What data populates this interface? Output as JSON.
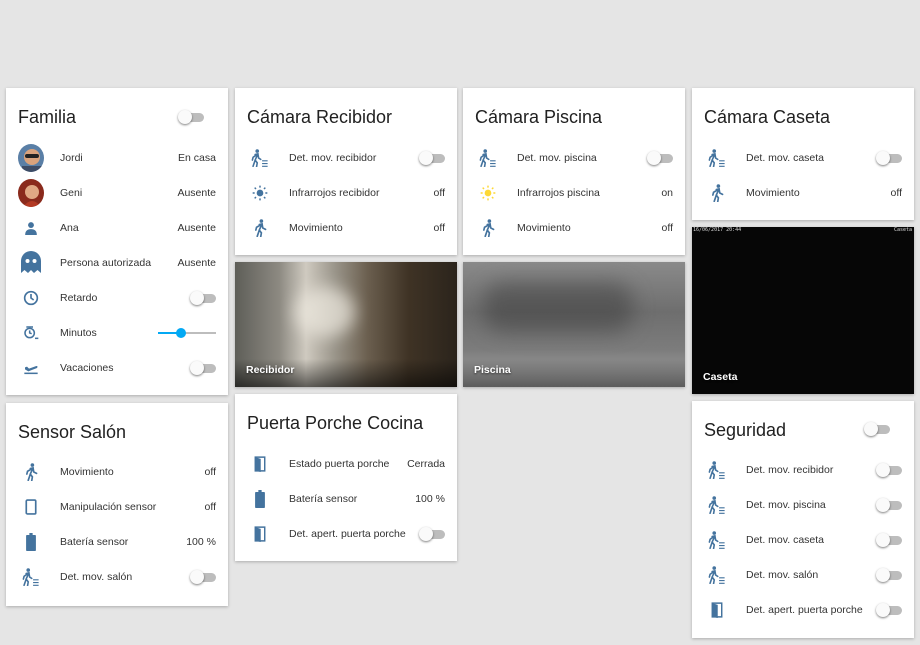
{
  "icons_color": "#44739e",
  "accent_color": "#03a9f4",
  "sun_color": "#fdd835",
  "familia": {
    "title": "Familia",
    "rows": [
      {
        "label": "Jordi",
        "value": "En casa",
        "icon": "avatar-jordi"
      },
      {
        "label": "Geni",
        "value": "Ausente",
        "icon": "avatar-geni"
      },
      {
        "label": "Ana",
        "value": "Ausente",
        "icon": "person-icon"
      },
      {
        "label": "Persona autorizada",
        "value": "Ausente",
        "icon": "ghost-icon"
      },
      {
        "label": "Retardo",
        "icon": "clock-icon"
      },
      {
        "label": "Minutos",
        "icon": "timer-icon",
        "slider_fraction": 0.4
      },
      {
        "label": "Vacaciones",
        "icon": "airplane-icon"
      }
    ]
  },
  "sensor_salon": {
    "title": "Sensor Salón",
    "rows": [
      {
        "label": "Movimiento",
        "value": "off",
        "icon": "walk-icon"
      },
      {
        "label": "Manipulación sensor",
        "value": "off",
        "icon": "tablet-icon"
      },
      {
        "label": "Batería sensor",
        "value": "100 %",
        "icon": "battery-icon"
      },
      {
        "label": "Det. mov. salón",
        "icon": "motion-detect-icon"
      }
    ]
  },
  "camara_recibidor": {
    "title": "Cámara Recibidor",
    "rows": [
      {
        "label": "Det. mov. recibidor",
        "icon": "motion-detect-icon"
      },
      {
        "label": "Infrarrojos recibidor",
        "value": "off",
        "icon": "brightness-icon"
      },
      {
        "label": "Movimiento",
        "value": "off",
        "icon": "walk-icon"
      }
    ],
    "feed_label": "Recibidor"
  },
  "camara_piscina": {
    "title": "Cámara Piscina",
    "rows": [
      {
        "label": "Det. mov. piscina",
        "icon": "motion-detect-icon"
      },
      {
        "label": "Infrarrojos piscina",
        "value": "on",
        "icon": "brightness-icon"
      },
      {
        "label": "Movimiento",
        "value": "off",
        "icon": "walk-icon"
      }
    ],
    "feed_label": "Piscina"
  },
  "camara_caseta": {
    "title": "Cámara Caseta",
    "rows": [
      {
        "label": "Det. mov. caseta",
        "icon": "motion-detect-icon"
      },
      {
        "label": "Movimiento",
        "value": "off",
        "icon": "walk-icon"
      }
    ],
    "feed_label": "Caseta",
    "feed_overlay_left": "16/06/2017 20:44",
    "feed_overlay_right": "Caseta"
  },
  "puerta_porche": {
    "title": "Puerta Porche Cocina",
    "rows": [
      {
        "label": "Estado puerta porche",
        "value": "Cerrada",
        "icon": "door-icon"
      },
      {
        "label": "Batería sensor",
        "value": "100 %",
        "icon": "battery-icon"
      },
      {
        "label": "Det. apert. puerta porche",
        "icon": "door-icon"
      }
    ]
  },
  "seguridad": {
    "title": "Seguridad",
    "rows": [
      {
        "label": "Det. mov. recibidor",
        "icon": "motion-detect-icon"
      },
      {
        "label": "Det. mov. piscina",
        "icon": "motion-detect-icon"
      },
      {
        "label": "Det. mov. caseta",
        "icon": "motion-detect-icon"
      },
      {
        "label": "Det. mov. salón",
        "icon": "motion-detect-icon"
      },
      {
        "label": "Det. apert. puerta porche",
        "icon": "door-icon"
      }
    ]
  }
}
